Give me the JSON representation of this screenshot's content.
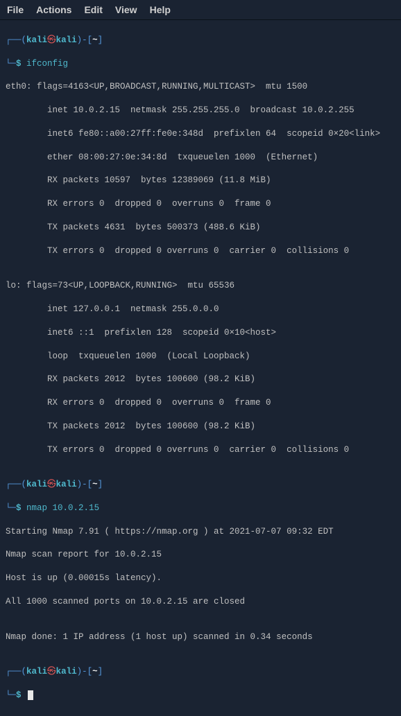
{
  "menubar": {
    "file": "File",
    "actions": "Actions",
    "edit": "Edit",
    "view": "View",
    "help": "Help"
  },
  "prompt": {
    "open_paren": "(",
    "user": "kali",
    "at": "㉿",
    "host": "kali",
    "close_paren": ")",
    "dash": "-",
    "path_open": "[",
    "path": "~",
    "path_close": "]",
    "corner_top": "┌──",
    "corner_bottom": "└─",
    "symbol": "$"
  },
  "cmd1": "ifconfig",
  "ifconfig_output": {
    "l1": "eth0: flags=4163<UP,BROADCAST,RUNNING,MULTICAST>  mtu 1500",
    "l2": "        inet 10.0.2.15  netmask 255.255.255.0  broadcast 10.0.2.255",
    "l3": "        inet6 fe80::a00:27ff:fe0e:348d  prefixlen 64  scopeid 0×20<link>",
    "l4": "        ether 08:00:27:0e:34:8d  txqueuelen 1000  (Ethernet)",
    "l5": "        RX packets 10597  bytes 12389069 (11.8 MiB)",
    "l6": "        RX errors 0  dropped 0  overruns 0  frame 0",
    "l7": "        TX packets 4631  bytes 500373 (488.6 KiB)",
    "l8": "        TX errors 0  dropped 0 overruns 0  carrier 0  collisions 0",
    "l9": "",
    "l10": "lo: flags=73<UP,LOOPBACK,RUNNING>  mtu 65536",
    "l11": "        inet 127.0.0.1  netmask 255.0.0.0",
    "l12": "        inet6 ::1  prefixlen 128  scopeid 0×10<host>",
    "l13": "        loop  txqueuelen 1000  (Local Loopback)",
    "l14": "        RX packets 2012  bytes 100600 (98.2 KiB)",
    "l15": "        RX errors 0  dropped 0  overruns 0  frame 0",
    "l16": "        TX packets 2012  bytes 100600 (98.2 KiB)",
    "l17": "        TX errors 0  dropped 0 overruns 0  carrier 0  collisions 0",
    "l18": ""
  },
  "cmd2": "nmap 10.0.2.15",
  "nmap_output": {
    "l1": "Starting Nmap 7.91 ( https://nmap.org ) at 2021-07-07 09:32 EDT",
    "l2": "Nmap scan report for 10.0.2.15",
    "l3": "Host is up (0.00015s latency).",
    "l4": "All 1000 scanned ports on 10.0.2.15 are closed",
    "l5": "",
    "l6": "Nmap done: 1 IP address (1 host up) scanned in 0.34 seconds",
    "l7": ""
  }
}
